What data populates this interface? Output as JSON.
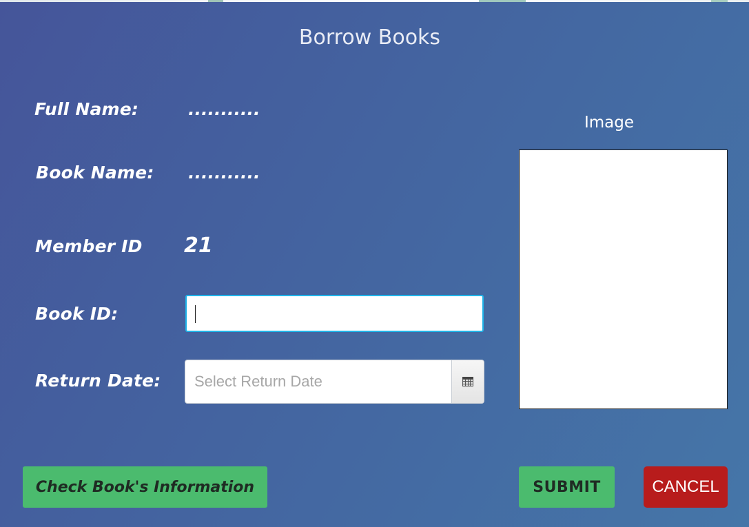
{
  "dialog": {
    "title": "Borrow Books"
  },
  "form": {
    "full_name_label": "Full Name:",
    "full_name_value": "...........",
    "book_name_label": "Book Name:",
    "book_name_value": "...........",
    "member_id_label": "Member ID",
    "member_id_value": "21",
    "book_id_label": "Book ID:",
    "book_id_value": "",
    "return_date_label": "Return Date:",
    "return_date_placeholder": "Select Return Date"
  },
  "image_panel": {
    "label": "Image"
  },
  "buttons": {
    "check_info": "Check Book's Information",
    "submit": "SUBMIT",
    "cancel": "CANCEL"
  },
  "colors": {
    "green_button": "#4bbb6e",
    "cancel_button": "#b81c1c",
    "focus_border": "#1fb3e8"
  },
  "icons": {
    "date_picker": "calendar-icon"
  }
}
